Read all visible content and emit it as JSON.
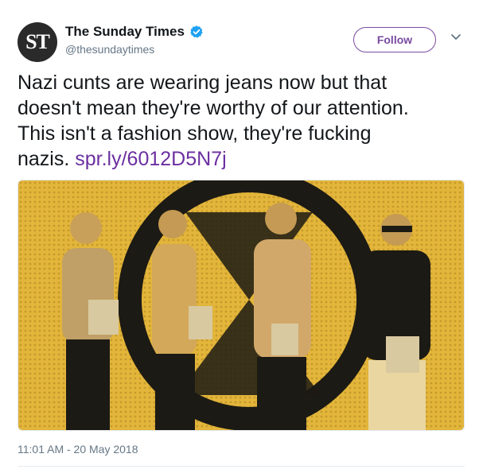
{
  "account": {
    "avatar_text": "ST",
    "display_name": "The Sunday Times",
    "handle": "@thesundaytimes",
    "verified": true
  },
  "actions": {
    "follow_label": "Follow",
    "more_icon": "chevron-down-icon"
  },
  "tweet": {
    "text": "Nazi cunts are wearing jeans now but that\ndoesn't mean they're worthy of our attention.\nThis isn't a fashion show, they're fucking\nnazis. ",
    "link": "spr.ly/6012D5N7j",
    "timestamp": "11:01 AM - 20 May 2018"
  },
  "colors": {
    "accent": "#7a4aa0",
    "link": "#6b2fa0",
    "verified": "#1da1f2",
    "media_tint": "#e8b938"
  }
}
